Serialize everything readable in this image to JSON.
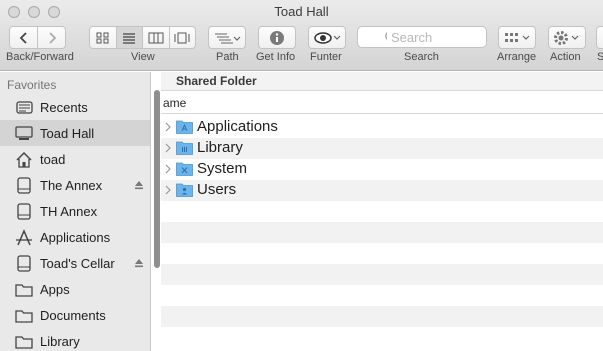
{
  "window": {
    "title": "Toad Hall"
  },
  "toolbar": {
    "back_forward_label": "Back/Forward",
    "view_label": "View",
    "path_label": "Path",
    "get_info_label": "Get Info",
    "funter_label": "Funter",
    "search_label": "Search",
    "search_placeholder": "Search",
    "arrange_label": "Arrange",
    "action_label": "Action",
    "share_label": "S"
  },
  "sidebar": {
    "header": "Favorites",
    "items": [
      {
        "label": "Recents",
        "icon": "recents-icon"
      },
      {
        "label": "Toad Hall",
        "icon": "computer-icon",
        "selected": true
      },
      {
        "label": "toad",
        "icon": "home-icon"
      },
      {
        "label": "The Annex",
        "icon": "drive-icon",
        "eject": true
      },
      {
        "label": "TH Annex",
        "icon": "drive-icon"
      },
      {
        "label": "Applications",
        "icon": "applications-icon"
      },
      {
        "label": "Toad's Cellar",
        "icon": "drive-icon",
        "eject": true
      },
      {
        "label": "Apps",
        "icon": "folder-icon"
      },
      {
        "label": "Documents",
        "icon": "folder-icon"
      },
      {
        "label": "Library",
        "icon": "folder-icon"
      }
    ]
  },
  "content": {
    "path_header": "Shared Folder",
    "column_name": "ame",
    "rows": [
      {
        "label": "Applications",
        "icon": "applications-folder-icon"
      },
      {
        "label": "Library",
        "icon": "library-folder-icon"
      },
      {
        "label": "System",
        "icon": "system-folder-icon"
      },
      {
        "label": "Users",
        "icon": "users-folder-icon"
      }
    ]
  },
  "colors": {
    "folder_blue": "#6cb4ec",
    "selection_gray": "#d4d4d4",
    "alt_row": "#f2f2f2"
  }
}
